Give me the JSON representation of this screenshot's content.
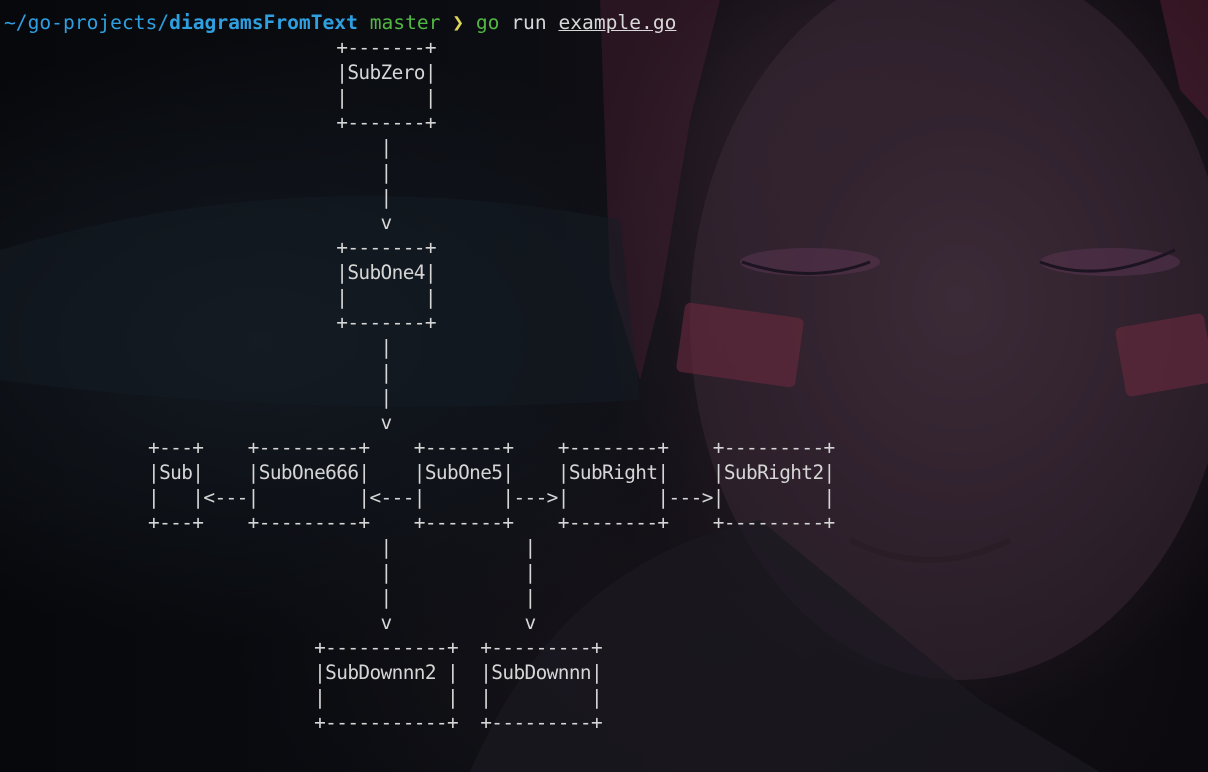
{
  "prompt": {
    "path": "~/go-projects/",
    "dir": "diagramsFromText",
    "branch": "master",
    "arrow": "❯",
    "command": "go",
    "subcommand": "run",
    "file": "example.go"
  },
  "diagram_text": "                 +-------+\n                 |SubZero|\n                 |       |\n                 +-------+\n                     |\n                     |\n                     |\n                     v\n                 +-------+\n                 |SubOne4|\n                 |       |\n                 +-------+\n                     |\n                     |\n                     |\n                     v\n+---+    +---------+    +-------+    +--------+    +---------+\n|Sub|    |SubOne666|    |SubOne5|    |SubRight|    |SubRight2|\n|   |<---|         |<---|       |--->|        |--->|         |\n+---+    +---------+    +-------+    +--------+    +---------+\n                     |            |\n                     |            |\n                     |            |\n                     v            v\n               +-----------+  +---------+\n               |SubDownnn2 |  |SubDownnn|\n               |           |  |         |\n               +-----------+  +---------+"
}
